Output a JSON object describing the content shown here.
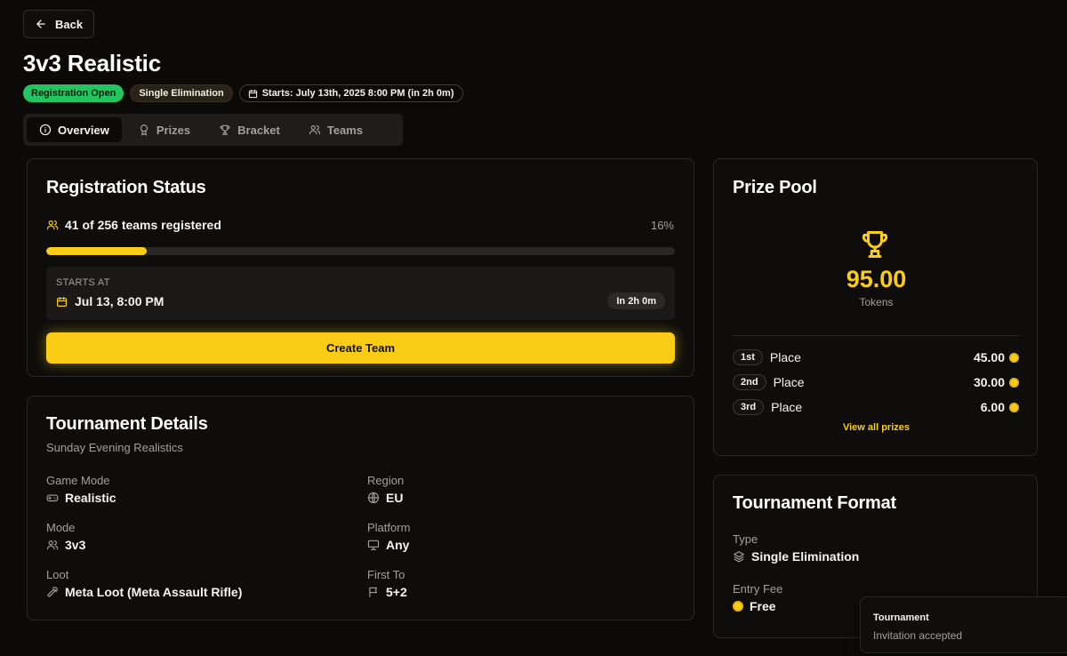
{
  "header": {
    "back_label": "Back",
    "title": "3v3 Realistic",
    "badges": {
      "status": "Registration Open",
      "format": "Single Elimination",
      "starts": "Starts: July 13th, 2025 8:00 PM (in 2h 0m)"
    }
  },
  "tabs": [
    {
      "label": "Overview",
      "icon": "info-icon",
      "active": true
    },
    {
      "label": "Prizes",
      "icon": "award-icon",
      "active": false
    },
    {
      "label": "Bracket",
      "icon": "trophy-icon",
      "active": false
    },
    {
      "label": "Teams",
      "icon": "users-icon",
      "active": false
    }
  ],
  "registration": {
    "title": "Registration Status",
    "registered_text": "41 of 256 teams registered",
    "percent_text": "16%",
    "progress_fraction": 0.16,
    "starts_label": "STARTS AT",
    "starts_date": "Jul 13, 8:00 PM",
    "countdown": "In 2h 0m",
    "create_button": "Create Team"
  },
  "details": {
    "title": "Tournament Details",
    "subtitle": "Sunday Evening Realistics",
    "items": {
      "game_mode": {
        "label": "Game Mode",
        "value": "Realistic",
        "icon": "gamepad-icon"
      },
      "region": {
        "label": "Region",
        "value": "EU",
        "icon": "globe-icon"
      },
      "mode": {
        "label": "Mode",
        "value": "3v3",
        "icon": "users-icon"
      },
      "platform": {
        "label": "Platform",
        "value": "Any",
        "icon": "monitor-icon"
      },
      "loot": {
        "label": "Loot",
        "value": "Meta Loot (Meta Assault Rifle)",
        "icon": "hammer-icon"
      },
      "first_to": {
        "label": "First To",
        "value": "5+2",
        "icon": "flag-icon"
      }
    }
  },
  "prize_pool": {
    "title": "Prize Pool",
    "amount": "95.00",
    "unit": "Tokens",
    "places": [
      {
        "rank": "1st",
        "label": "Place",
        "amount": "45.00"
      },
      {
        "rank": "2nd",
        "label": "Place",
        "amount": "30.00"
      },
      {
        "rank": "3rd",
        "label": "Place",
        "amount": "6.00"
      }
    ],
    "view_all": "View all prizes"
  },
  "format": {
    "title": "Tournament Format",
    "type_label": "Type",
    "type_value": "Single Elimination",
    "fee_label": "Entry Fee",
    "fee_value": "Free"
  },
  "toast": {
    "title": "Tournament",
    "message": "Invitation accepted"
  },
  "colors": {
    "accent": "#facc15",
    "status_green": "#22c55e",
    "background": "#0b0a09"
  }
}
